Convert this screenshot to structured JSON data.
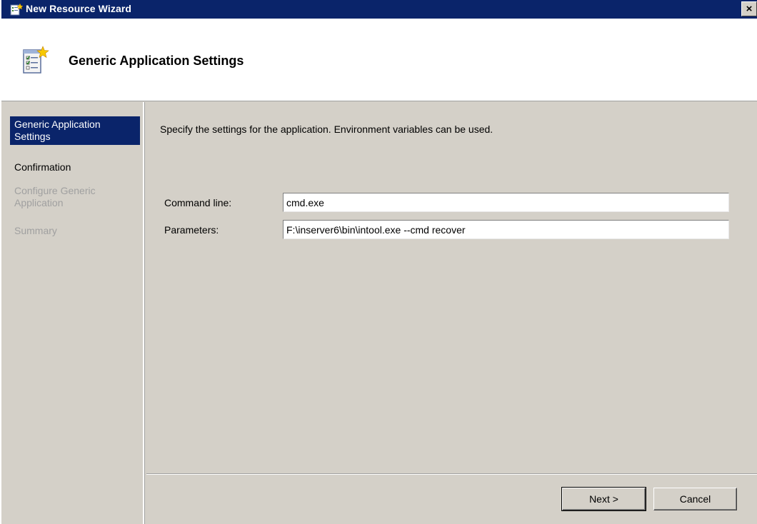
{
  "window": {
    "title": "New Resource Wizard",
    "close_glyph": "×",
    "title_icon": "wizard-icon"
  },
  "header": {
    "title": "Generic Application Settings",
    "icon": "checklist-wizard-icon"
  },
  "nav": {
    "items": [
      {
        "label": "Generic Application Settings",
        "state": "selected"
      },
      {
        "label": "Confirmation",
        "state": "enabled"
      },
      {
        "label": "Configure Generic Application",
        "state": "disabled"
      },
      {
        "label": "Summary",
        "state": "disabled"
      }
    ]
  },
  "main": {
    "instruction": "Specify the settings for the application.  Environment variables can be used.",
    "command_line": {
      "label": "Command line:",
      "value": "cmd.exe"
    },
    "parameters": {
      "label": "Parameters:",
      "value": "F:\\inserver6\\bin\\intool.exe --cmd recover"
    }
  },
  "buttons": {
    "next": "Next >",
    "cancel": "Cancel"
  },
  "colors": {
    "titlebar": "#0a246a",
    "face": "#d4d0c8",
    "selection": "#0a246a",
    "disabled_text": "#a0a0a0"
  }
}
